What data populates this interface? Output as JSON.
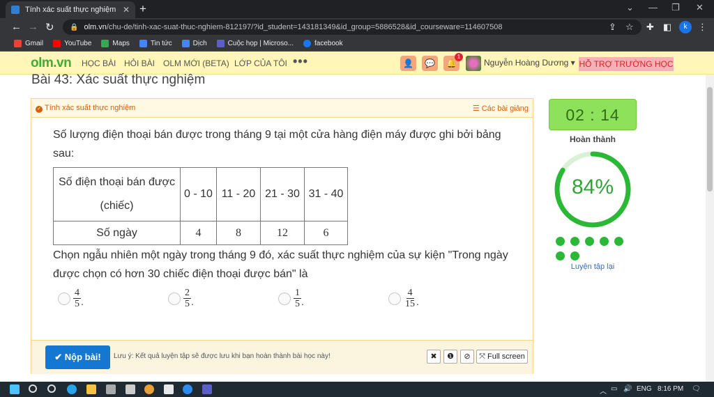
{
  "browser": {
    "tab_title": "Tính xác suất thực nghiệm - Họ",
    "tab_close": "✕",
    "new_tab": "+",
    "url_domain": "olm.vn",
    "url_path": "/chu-de/tinh-xac-suat-thuc-nghiem-812197/?id_student=143181349&id_group=5886528&id_courseware=114607508",
    "profile_initial": "k",
    "bookmarks": [
      {
        "label": "Gmail",
        "color": "#ea4335"
      },
      {
        "label": "YouTube",
        "color": "#ff0000"
      },
      {
        "label": "Maps",
        "color": "#34a853"
      },
      {
        "label": "Tin tức",
        "color": "#4285f4"
      },
      {
        "label": "Dịch",
        "color": "#4285f4"
      },
      {
        "label": "Cuộc họp | Microso...",
        "color": "#5b5fc7"
      },
      {
        "label": "facebook",
        "color": "#1877f2"
      }
    ]
  },
  "site": {
    "logo_a": "olm",
    "logo_b": ".vn",
    "nav": [
      "HỌC BÀI",
      "HỎI BÀI",
      "OLM MỚI (BETA)",
      "LỚP CỦA TÔI"
    ],
    "more": "•••",
    "notif_count": "1",
    "user_name": "Nguyễn Hoàng Dương ▾",
    "support": "HỖ TRỢ TRƯỜNG HỌC"
  },
  "page": {
    "title": "Bài 43: Xác suất thực nghiệm",
    "card_title": "Tính xác suất thực nghiệm",
    "lessons_link": "☰ Các bài giảng",
    "question_intro": "Số lượng điện thoại bán được trong tháng 9 tại một cửa hàng điện máy được ghi bởi bảng sau:",
    "table": {
      "row1_header": "Số điện thoại bán được (chiếc)",
      "ranges": [
        "0 - 10",
        "11 - 20",
        "21 - 30",
        "31 - 40"
      ],
      "row2_header": "Số ngày",
      "days": [
        "4",
        "8",
        "12",
        "6"
      ]
    },
    "question": "Chọn ngẫu nhiên một ngày trong tháng 9 đó, xác suất thực nghiệm của sự kiện \"Trong ngày được chọn có hơn 30 chiếc điện thoại được bán\" là",
    "options": [
      {
        "num": "4",
        "den": "5"
      },
      {
        "num": "2",
        "den": "5"
      },
      {
        "num": "1",
        "den": "5"
      },
      {
        "num": "4",
        "den": "15"
      }
    ],
    "option_dot": ".",
    "submit": "✔ Nộp bài!",
    "note": "Lưu ý: Kết quả luyện tập sẽ được lưu khi bạn hoàn thành bài học này!",
    "tools": [
      "✖",
      "❶",
      "⊘",
      "⤧ Full screen"
    ]
  },
  "sidebar": {
    "timer": "02 : 14",
    "done_label": "Hoàn thành",
    "percent": "84%",
    "progress": 0.84,
    "ring_color": "#2bb836",
    "dots_completed": 7,
    "redo": "Luyện tập lại"
  },
  "taskbar": {
    "language": "ENG",
    "time": "8:16 PM"
  }
}
